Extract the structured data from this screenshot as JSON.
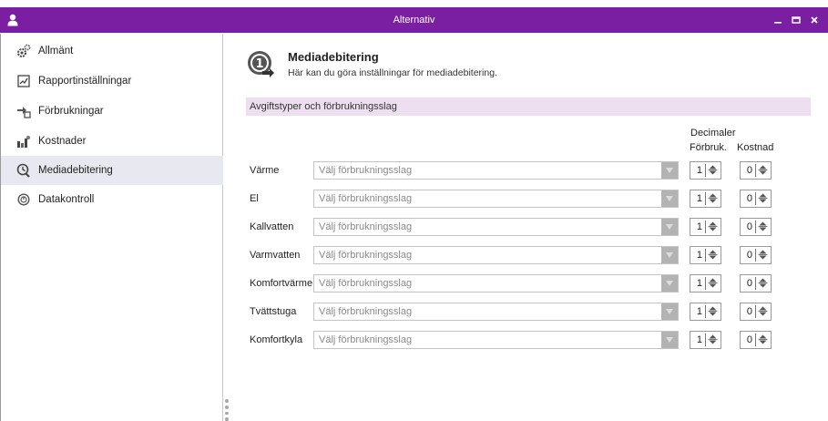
{
  "window": {
    "title": "Alternativ",
    "icons": {
      "user": "user-icon",
      "minimize": "minimize-icon",
      "maximize": "maximize-icon",
      "close": "close-icon"
    }
  },
  "sidebar": {
    "items": [
      {
        "label": "Allmänt",
        "icon": "gears-icon"
      },
      {
        "label": "Rapportinställningar",
        "icon": "report-icon"
      },
      {
        "label": "Förbrukningar",
        "icon": "consumption-icon"
      },
      {
        "label": "Kostnader",
        "icon": "costs-icon"
      },
      {
        "label": "Mediadebitering",
        "icon": "media-billing-icon",
        "active": true
      },
      {
        "label": "Datakontroll",
        "icon": "datacheck-icon"
      }
    ]
  },
  "main": {
    "title": "Mediadebitering",
    "subtitle": "Här kan du göra inställningar för mediadebitering.",
    "section": "Avgiftstyper och förbrukningsslag",
    "decimals_header": "Decimaler",
    "col_consumption": "Förbruk.",
    "col_cost": "Kostnad",
    "rows": [
      {
        "label": "Värme",
        "placeholder": "Välj förbrukningsslag",
        "forbruk": "1",
        "kostnad": "0"
      },
      {
        "label": "El",
        "placeholder": "Välj förbrukningsslag",
        "forbruk": "1",
        "kostnad": "0"
      },
      {
        "label": "Kallvatten",
        "placeholder": "Välj förbrukningsslag",
        "forbruk": "1",
        "kostnad": "0"
      },
      {
        "label": "Varmvatten",
        "placeholder": "Välj förbrukningsslag",
        "forbruk": "1",
        "kostnad": "0"
      },
      {
        "label": "Komfortvärme",
        "placeholder": "Välj förbrukningsslag",
        "forbruk": "1",
        "kostnad": "0"
      },
      {
        "label": "Tvättstuga",
        "placeholder": "Välj förbrukningsslag",
        "forbruk": "1",
        "kostnad": "0"
      },
      {
        "label": "Komfortkyla",
        "placeholder": "Välj förbrukningsslag",
        "forbruk": "1",
        "kostnad": "0"
      }
    ]
  },
  "colors": {
    "titlebar": "#7a1fa2",
    "section": "#eddff0",
    "active_item": "#e8e8f0"
  }
}
